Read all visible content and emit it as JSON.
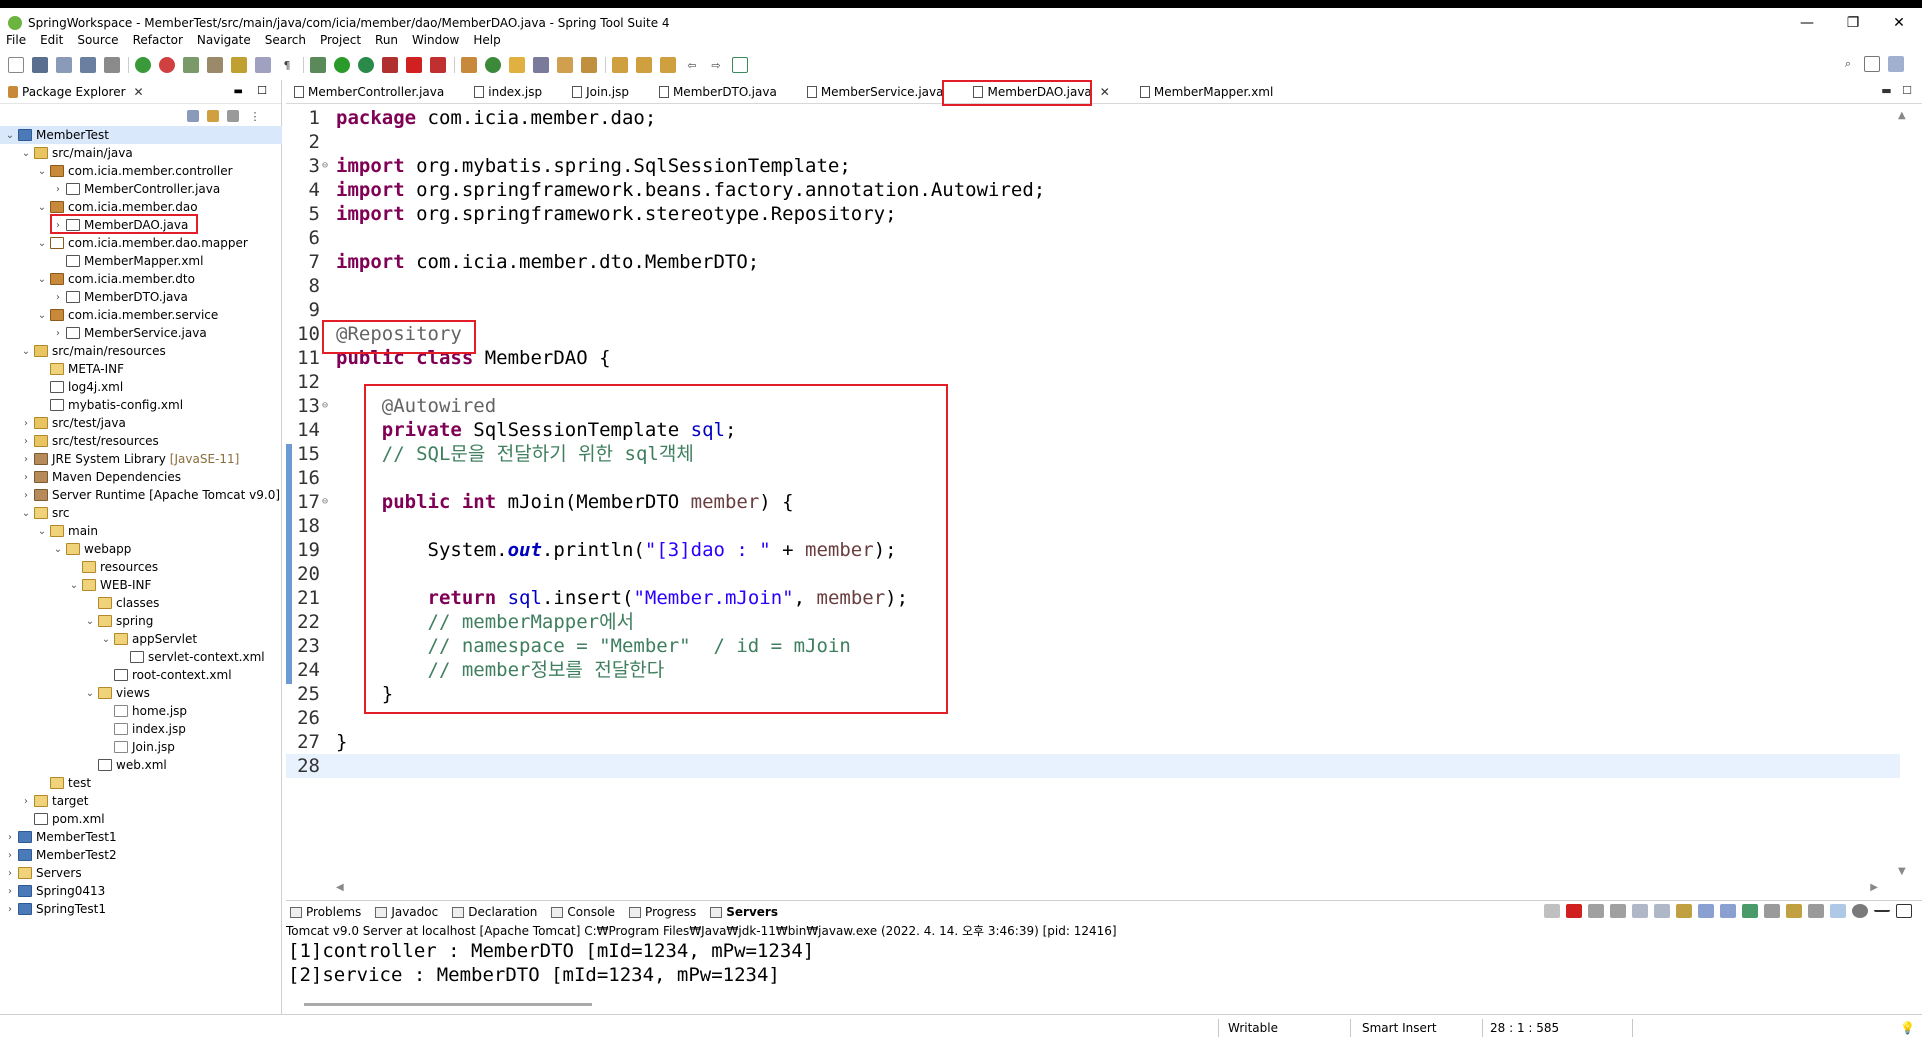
{
  "window": {
    "title": "SpringWorkspace - MemberTest/src/main/java/com/icia/member/dao/MemberDAO.java - Spring Tool Suite 4",
    "minimize": "—",
    "maximize": "❐",
    "close": "✕"
  },
  "menu": [
    "File",
    "Edit",
    "Source",
    "Refactor",
    "Navigate",
    "Search",
    "Project",
    "Run",
    "Window",
    "Help"
  ],
  "package_explorer": {
    "title": "Package Explorer",
    "tree": [
      {
        "label": "MemberTest",
        "depth": 0,
        "arrow": "v",
        "icon": "project",
        "selected": true
      },
      {
        "label": "src/main/java",
        "depth": 1,
        "arrow": "v",
        "icon": "srcfolder"
      },
      {
        "label": "com.icia.member.controller",
        "depth": 2,
        "arrow": "v",
        "icon": "package"
      },
      {
        "label": "MemberController.java",
        "depth": 3,
        "arrow": ">",
        "icon": "java"
      },
      {
        "label": "com.icia.member.dao",
        "depth": 2,
        "arrow": "v",
        "icon": "package"
      },
      {
        "label": "MemberDAO.java",
        "depth": 3,
        "arrow": ">",
        "icon": "java",
        "highlight": true
      },
      {
        "label": "com.icia.member.dao.mapper",
        "depth": 2,
        "arrow": "v",
        "icon": "package-empty"
      },
      {
        "label": "MemberMapper.xml",
        "depth": 3,
        "arrow": "",
        "icon": "xml"
      },
      {
        "label": "com.icia.member.dto",
        "depth": 2,
        "arrow": "v",
        "icon": "package"
      },
      {
        "label": "MemberDTO.java",
        "depth": 3,
        "arrow": ">",
        "icon": "java"
      },
      {
        "label": "com.icia.member.service",
        "depth": 2,
        "arrow": "v",
        "icon": "package"
      },
      {
        "label": "MemberService.java",
        "depth": 3,
        "arrow": ">",
        "icon": "java"
      },
      {
        "label": "src/main/resources",
        "depth": 1,
        "arrow": "v",
        "icon": "srcfolder"
      },
      {
        "label": "META-INF",
        "depth": 2,
        "arrow": "",
        "icon": "folder"
      },
      {
        "label": "log4j.xml",
        "depth": 2,
        "arrow": "",
        "icon": "xml"
      },
      {
        "label": "mybatis-config.xml",
        "depth": 2,
        "arrow": "",
        "icon": "xml"
      },
      {
        "label": "src/test/java",
        "depth": 1,
        "arrow": ">",
        "icon": "srcfolder"
      },
      {
        "label": "src/test/resources",
        "depth": 1,
        "arrow": ">",
        "icon": "srcfolder"
      },
      {
        "label": "JRE System Library",
        "depth": 1,
        "arrow": ">",
        "icon": "lib",
        "suffix": "[JavaSE-11]"
      },
      {
        "label": "Maven Dependencies",
        "depth": 1,
        "arrow": ">",
        "icon": "lib"
      },
      {
        "label": "Server Runtime [Apache Tomcat v9.0]",
        "depth": 1,
        "arrow": ">",
        "icon": "lib"
      },
      {
        "label": "src",
        "depth": 1,
        "arrow": "v",
        "icon": "folder"
      },
      {
        "label": "main",
        "depth": 2,
        "arrow": "v",
        "icon": "folder"
      },
      {
        "label": "webapp",
        "depth": 3,
        "arrow": "v",
        "icon": "folder"
      },
      {
        "label": "resources",
        "depth": 4,
        "arrow": "",
        "icon": "folder"
      },
      {
        "label": "WEB-INF",
        "depth": 4,
        "arrow": "v",
        "icon": "folder"
      },
      {
        "label": "classes",
        "depth": 5,
        "arrow": "",
        "icon": "folder"
      },
      {
        "label": "spring",
        "depth": 5,
        "arrow": "v",
        "icon": "folder"
      },
      {
        "label": "appServlet",
        "depth": 6,
        "arrow": "v",
        "icon": "folder"
      },
      {
        "label": "servlet-context.xml",
        "depth": 7,
        "arrow": "",
        "icon": "xml"
      },
      {
        "label": "root-context.xml",
        "depth": 6,
        "arrow": "",
        "icon": "xml"
      },
      {
        "label": "views",
        "depth": 5,
        "arrow": "v",
        "icon": "folder"
      },
      {
        "label": "home.jsp",
        "depth": 6,
        "arrow": "",
        "icon": "jsp"
      },
      {
        "label": "index.jsp",
        "depth": 6,
        "arrow": "",
        "icon": "jsp"
      },
      {
        "label": "Join.jsp",
        "depth": 6,
        "arrow": "",
        "icon": "jsp"
      },
      {
        "label": "web.xml",
        "depth": 5,
        "arrow": "",
        "icon": "xml"
      },
      {
        "label": "test",
        "depth": 2,
        "arrow": "",
        "icon": "folder"
      },
      {
        "label": "target",
        "depth": 1,
        "arrow": ">",
        "icon": "folder"
      },
      {
        "label": "pom.xml",
        "depth": 1,
        "arrow": "",
        "icon": "xml"
      },
      {
        "label": "MemberTest1",
        "depth": 0,
        "arrow": ">",
        "icon": "project"
      },
      {
        "label": "MemberTest2",
        "depth": 0,
        "arrow": ">",
        "icon": "project"
      },
      {
        "label": "Servers",
        "depth": 0,
        "arrow": ">",
        "icon": "folder"
      },
      {
        "label": "Spring0413",
        "depth": 0,
        "arrow": ">",
        "icon": "project"
      },
      {
        "label": "SpringTest1",
        "depth": 0,
        "arrow": ">",
        "icon": "project"
      }
    ]
  },
  "editor_tabs": [
    {
      "label": "MemberController.java"
    },
    {
      "label": "index.jsp"
    },
    {
      "label": "Join.jsp"
    },
    {
      "label": "MemberDTO.java"
    },
    {
      "label": "MemberService.java"
    },
    {
      "label": "MemberDAO.java",
      "active": true
    },
    {
      "label": "MemberMapper.xml"
    }
  ],
  "code_lines": [
    {
      "n": "1",
      "fold": "",
      "tokens": [
        [
          "kw",
          "package"
        ],
        [
          "",
          " com.icia.member.dao;"
        ]
      ]
    },
    {
      "n": "2",
      "fold": "",
      "tokens": []
    },
    {
      "n": "3",
      "fold": "⊖",
      "tokens": [
        [
          "kw",
          "import"
        ],
        [
          "",
          " org.mybatis.spring.SqlSessionTemplate;"
        ]
      ]
    },
    {
      "n": "4",
      "fold": "",
      "tokens": [
        [
          "kw",
          "import"
        ],
        [
          "",
          " org.springframework.beans.factory.annotation.Autowired;"
        ]
      ]
    },
    {
      "n": "5",
      "fold": "",
      "tokens": [
        [
          "kw",
          "import"
        ],
        [
          "",
          " org.springframework.stereotype.Repository;"
        ]
      ]
    },
    {
      "n": "6",
      "fold": "",
      "tokens": []
    },
    {
      "n": "7",
      "fold": "",
      "tokens": [
        [
          "kw",
          "import"
        ],
        [
          "",
          " com.icia.member.dto.MemberDTO;"
        ]
      ]
    },
    {
      "n": "8",
      "fold": "",
      "tokens": []
    },
    {
      "n": "9",
      "fold": "",
      "tokens": []
    },
    {
      "n": "10",
      "fold": "",
      "tokens": [
        [
          "ann",
          "@Repository"
        ]
      ]
    },
    {
      "n": "11",
      "fold": "",
      "tokens": [
        [
          "kw",
          "public"
        ],
        [
          "",
          " "
        ],
        [
          "kw",
          "class"
        ],
        [
          "",
          " MemberDAO {"
        ]
      ]
    },
    {
      "n": "12",
      "fold": "",
      "tokens": []
    },
    {
      "n": "13",
      "fold": "⊖",
      "tokens": [
        [
          "",
          "    "
        ],
        [
          "ann",
          "@Autowired"
        ]
      ]
    },
    {
      "n": "14",
      "fold": "",
      "tokens": [
        [
          "",
          "    "
        ],
        [
          "kw",
          "private"
        ],
        [
          "",
          " SqlSessionTemplate "
        ],
        [
          "fld",
          "sql"
        ],
        [
          "",
          ";"
        ]
      ]
    },
    {
      "n": "15",
      "fold": "",
      "tokens": [
        [
          "",
          "    "
        ],
        [
          "cm",
          "// SQL문을 전달하기 위한 sql객체"
        ]
      ]
    },
    {
      "n": "16",
      "fold": "",
      "tokens": []
    },
    {
      "n": "17",
      "fold": "⊖",
      "tokens": [
        [
          "",
          "    "
        ],
        [
          "kw",
          "public"
        ],
        [
          "",
          " "
        ],
        [
          "kw",
          "int"
        ],
        [
          "",
          " mJoin(MemberDTO "
        ],
        [
          "param",
          "member"
        ],
        [
          "",
          ") {"
        ]
      ]
    },
    {
      "n": "18",
      "fold": "",
      "tokens": []
    },
    {
      "n": "19",
      "fold": "",
      "tokens": [
        [
          "",
          "        System."
        ],
        [
          "static-f",
          "out"
        ],
        [
          "",
          ".println("
        ],
        [
          "str",
          "\"[3]dao : \""
        ],
        [
          "",
          " + "
        ],
        [
          "param",
          "member"
        ],
        [
          "",
          ");"
        ]
      ]
    },
    {
      "n": "20",
      "fold": "",
      "tokens": []
    },
    {
      "n": "21",
      "fold": "",
      "tokens": [
        [
          "",
          "        "
        ],
        [
          "kw",
          "return"
        ],
        [
          "",
          " "
        ],
        [
          "fld",
          "sql"
        ],
        [
          "",
          ".insert("
        ],
        [
          "str",
          "\"Member.mJoin\""
        ],
        [
          "",
          ", "
        ],
        [
          "param",
          "member"
        ],
        [
          "",
          ");"
        ]
      ]
    },
    {
      "n": "22",
      "fold": "",
      "tokens": [
        [
          "",
          "        "
        ],
        [
          "cm",
          "// memberMapper에서"
        ]
      ]
    },
    {
      "n": "23",
      "fold": "",
      "tokens": [
        [
          "",
          "        "
        ],
        [
          "cm",
          "// namespace = \"Member\"  / id = mJoin"
        ]
      ]
    },
    {
      "n": "24",
      "fold": "",
      "tokens": [
        [
          "",
          "        "
        ],
        [
          "cm",
          "// member정보를 전달한다"
        ]
      ]
    },
    {
      "n": "25",
      "fold": "",
      "tokens": [
        [
          "",
          "    }"
        ]
      ]
    },
    {
      "n": "26",
      "fold": "",
      "tokens": []
    },
    {
      "n": "27",
      "fold": "",
      "tokens": [
        [
          "",
          "}"
        ]
      ]
    },
    {
      "n": "28",
      "fold": "",
      "tokens": [],
      "current": true
    }
  ],
  "console": {
    "tabs": [
      {
        "label": "Problems"
      },
      {
        "label": "Javadoc"
      },
      {
        "label": "Declaration"
      },
      {
        "label": "Console"
      },
      {
        "label": "Progress"
      },
      {
        "label": "Servers",
        "bold": true
      }
    ],
    "description": "Tomcat v9.0 Server at localhost [Apache Tomcat] C:₩Program Files₩Java₩jdk-11₩bin₩javaw.exe  (2022. 4. 14. 오후 3:46:39) [pid: 12416]",
    "lines": [
      "[1]controller : MemberDTO [mId=1234, mPw=1234]",
      "[2]service : MemberDTO [mId=1234, mPw=1234]"
    ]
  },
  "status": {
    "writable": "Writable",
    "insert_mode": "Smart Insert",
    "position": "28 : 1 : 585"
  },
  "colors": {
    "highlight_red": "#e41e26",
    "keyword": "#7f0055",
    "comment": "#3f7f5f",
    "string": "#2a00ff",
    "field": "#0000c0"
  }
}
